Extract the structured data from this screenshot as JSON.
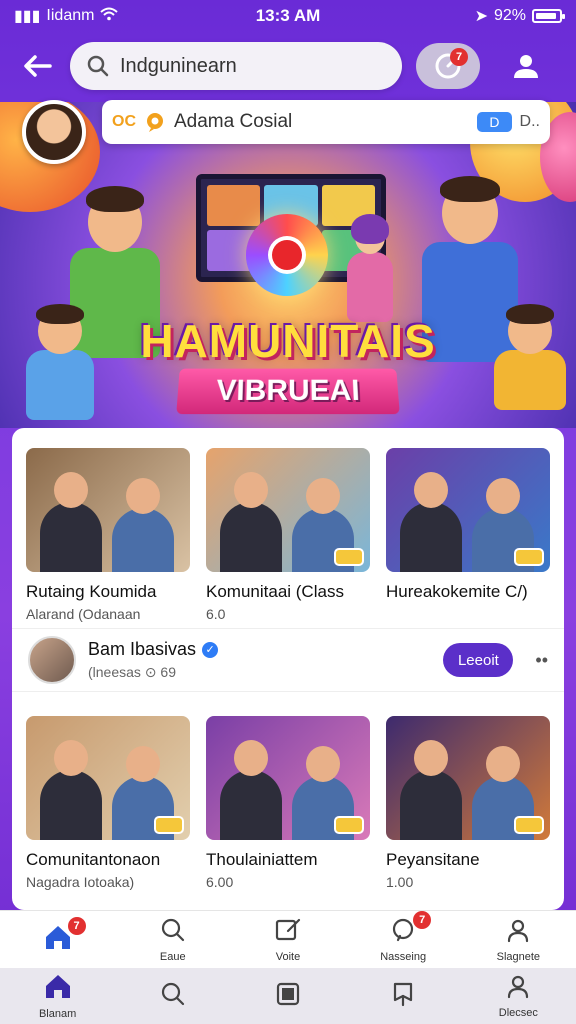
{
  "status": {
    "carrier": "Iidanm",
    "time": "13:3 AM",
    "battery_text": "92%",
    "battery_level": 0.92
  },
  "search": {
    "value": "Indguninearn"
  },
  "notifications": {
    "badge": "7"
  },
  "profile_card": {
    "prefix": "OC",
    "name": "Adama Cosial",
    "pill": "D",
    "more": "D.."
  },
  "banner": {
    "title": "HAMUNITAIS",
    "subtitle": "VIBRUEAI"
  },
  "grid1": [
    {
      "title": "Rutaing Koumida",
      "sub": "Alarand (Odanaan",
      "colors": [
        "#8b6a4a",
        "#d9c2a4"
      ]
    },
    {
      "title": "Komunitaai (Class",
      "sub": "6.0",
      "colors": [
        "#e6a36c",
        "#7ab6d9"
      ]
    },
    {
      "title": "Hureakokemite C/)",
      "sub": "",
      "colors": [
        "#6b3fa8",
        "#3a79c9"
      ]
    }
  ],
  "user_row": {
    "name": "Bam Ibasivas",
    "meta": "(lneesas ⊙ 69",
    "follow_label": "Leeoit",
    "more": "••"
  },
  "grid2": [
    {
      "title": "Comunitantonaon",
      "sub": "Nagadra Iotoaka)",
      "colors": [
        "#c79a6e",
        "#e2cfae"
      ]
    },
    {
      "title": "Thoulainiattem",
      "sub": "6.00",
      "colors": [
        "#7a3fa6",
        "#d97ab8"
      ]
    },
    {
      "title": "Peyansitane",
      "sub": "1.00",
      "colors": [
        "#3d2a6e",
        "#d17a3a"
      ]
    }
  ],
  "tabs_top": [
    {
      "label": "",
      "icon": "home-icon",
      "badge": "7"
    },
    {
      "label": "Eaue",
      "icon": "search-icon",
      "badge": ""
    },
    {
      "label": "Voite",
      "icon": "edit-icon",
      "badge": ""
    },
    {
      "label": "Nasseing",
      "icon": "message-icon",
      "badge": "7"
    },
    {
      "label": "Slagnete",
      "icon": "user-icon",
      "badge": ""
    }
  ],
  "tabs_bottom": [
    {
      "label": "Blanam",
      "icon": "home-icon"
    },
    {
      "label": "",
      "icon": "search-icon"
    },
    {
      "label": "",
      "icon": "square-icon"
    },
    {
      "label": "",
      "icon": "bookmark-icon"
    },
    {
      "label": "Dlecsec",
      "icon": "user-icon"
    }
  ],
  "colors": {
    "accent": "#5b2fc9",
    "badge": "#e23030",
    "home_active": "#2a5bd8"
  }
}
